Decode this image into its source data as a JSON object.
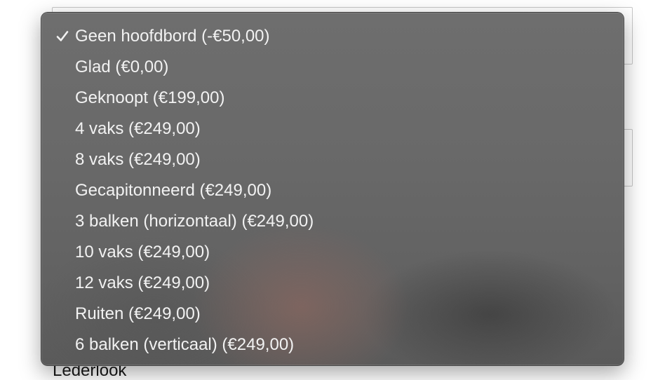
{
  "background": {
    "partial_label": "Lederlook"
  },
  "dropdown": {
    "selected_index": 0,
    "options": [
      {
        "label": "Geen hoofdbord (-€50,00)",
        "selected": true
      },
      {
        "label": "Glad (€0,00)",
        "selected": false
      },
      {
        "label": "Geknoopt (€199,00)",
        "selected": false
      },
      {
        "label": "4 vaks (€249,00)",
        "selected": false
      },
      {
        "label": "8 vaks (€249,00)",
        "selected": false
      },
      {
        "label": "Gecapitonneerd (€249,00)",
        "selected": false
      },
      {
        "label": "3 balken (horizontaal) (€249,00)",
        "selected": false
      },
      {
        "label": "10 vaks (€249,00)",
        "selected": false
      },
      {
        "label": "12 vaks (€249,00)",
        "selected": false
      },
      {
        "label": "Ruiten (€249,00)",
        "selected": false
      },
      {
        "label": "6 balken (verticaal) (€249,00)",
        "selected": false
      }
    ],
    "check_icon": "checkmark-icon",
    "colors": {
      "text": "#f2f2f2",
      "panel": "#686868"
    }
  }
}
